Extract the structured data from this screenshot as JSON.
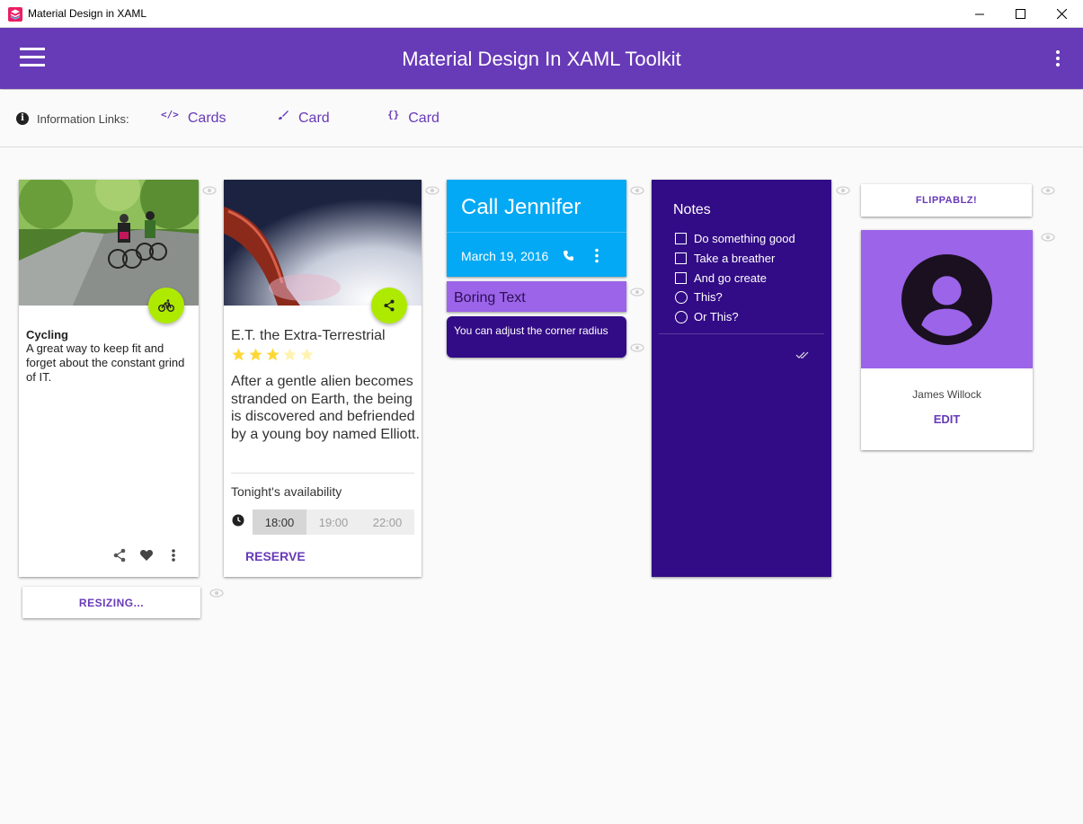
{
  "window": {
    "title": "Material Design in XAML"
  },
  "appbar": {
    "title": "Material Design In XAML Toolkit"
  },
  "info": {
    "label": "Information Links:",
    "links": [
      {
        "icon": "code-icon",
        "glyph": "</>",
        "label": "Cards"
      },
      {
        "icon": "brush-icon",
        "glyph": "",
        "label": "Card"
      },
      {
        "icon": "braces-icon",
        "glyph": "{}",
        "label": "Card"
      }
    ]
  },
  "cycling": {
    "title": "Cycling",
    "description": "A great way to keep fit and forget about the constant grind of IT."
  },
  "resizing": {
    "label": "RESIZING..."
  },
  "et": {
    "title": "E.T. the Extra-Terrestrial",
    "rating": 3,
    "rating_max": 5,
    "description": "After a gentle alien becomes stranded on Earth, the being is discovered and befriended by a young boy named Elliott.",
    "availability_label": "Tonight's availability",
    "times": [
      "18:00",
      "19:00",
      "22:00"
    ],
    "selected_time": "18:00",
    "reserve_label": "RESERVE"
  },
  "call": {
    "title": "Call Jennifer",
    "date": "March 19, 2016"
  },
  "boring": {
    "text": "Boring Text"
  },
  "radius": {
    "text": "You can adjust the corner radius"
  },
  "notes": {
    "title": "Notes",
    "checks": [
      "Do something good",
      "Take a breather",
      "And go create"
    ],
    "radios": [
      "This?",
      "Or This?"
    ]
  },
  "flippable": {
    "label": "FLIPPABLZ!"
  },
  "profile": {
    "name": "James Willock",
    "edit_label": "EDIT"
  },
  "colors": {
    "primary": "#673ab7",
    "accent_fab": "#aeea00",
    "call_card": "#03a9f4",
    "light_purple": "#9c64e8",
    "dark_purple": "#320b86",
    "star": "#fdd835"
  }
}
